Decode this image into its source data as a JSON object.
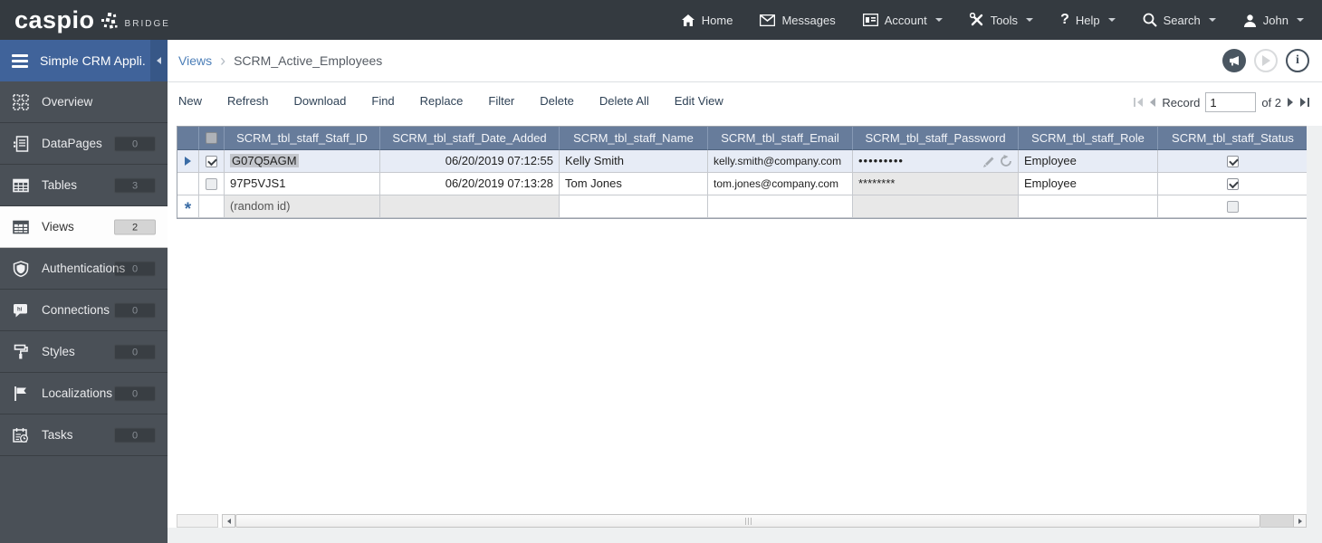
{
  "navbar": {
    "logo": "caspio",
    "logo_suffix": "BRIDGE",
    "items": [
      {
        "label": "Home",
        "icon": "home-icon",
        "dropdown": false
      },
      {
        "label": "Messages",
        "icon": "messages-icon",
        "dropdown": false
      },
      {
        "label": "Account",
        "icon": "account-icon",
        "dropdown": true
      },
      {
        "label": "Tools",
        "icon": "tools-icon",
        "dropdown": true
      },
      {
        "label": "Help",
        "icon": "help-icon",
        "dropdown": true
      },
      {
        "label": "Search",
        "icon": "search-icon",
        "dropdown": true
      },
      {
        "label": "John",
        "icon": "user-icon",
        "dropdown": true
      }
    ]
  },
  "sidebar": {
    "app_name": "Simple CRM Appli...",
    "items": [
      {
        "label": "Overview",
        "icon": "overview-icon",
        "badge": null,
        "selected": false
      },
      {
        "label": "DataPages",
        "icon": "datapages-icon",
        "badge": "0",
        "selected": false
      },
      {
        "label": "Tables",
        "icon": "tables-icon",
        "badge": "3",
        "selected": false
      },
      {
        "label": "Views",
        "icon": "views-icon",
        "badge": "2",
        "selected": true
      },
      {
        "label": "Authentications",
        "icon": "authentications-icon",
        "badge": "0",
        "selected": false
      },
      {
        "label": "Connections",
        "icon": "connections-icon",
        "badge": "0",
        "selected": false
      },
      {
        "label": "Styles",
        "icon": "styles-icon",
        "badge": "0",
        "selected": false
      },
      {
        "label": "Localizations",
        "icon": "localizations-icon",
        "badge": "0",
        "selected": false
      },
      {
        "label": "Tasks",
        "icon": "tasks-icon",
        "badge": "0",
        "selected": false
      }
    ]
  },
  "breadcrumb": {
    "parent": "Views",
    "current": "SCRM_Active_Employees"
  },
  "page_header_icons": [
    "announcement-icon",
    "play-icon",
    "info-icon"
  ],
  "toolbar": {
    "buttons": [
      "New",
      "Refresh",
      "Download",
      "Find",
      "Replace",
      "Filter",
      "Delete",
      "Delete All",
      "Edit View"
    ]
  },
  "record_nav": {
    "label": "Record",
    "current": "1",
    "of_label": "of 2"
  },
  "table": {
    "columns": [
      "SCRM_tbl_staff_Staff_ID",
      "SCRM_tbl_staff_Date_Added",
      "SCRM_tbl_staff_Name",
      "SCRM_tbl_staff_Email",
      "SCRM_tbl_staff_Password",
      "SCRM_tbl_staff_Role",
      "SCRM_tbl_staff_Status"
    ],
    "rows": [
      {
        "staff_id": "G07Q5AGM",
        "date_added": "06/20/2019 07:12:55",
        "name": "Kelly Smith",
        "email": "kelly.smith@company.com",
        "password": "•••••••••",
        "role": "Employee",
        "status_checked": true,
        "row_checked": true,
        "selected": true
      },
      {
        "staff_id": "97P5VJS1",
        "date_added": "06/20/2019 07:13:28",
        "name": "Tom Jones",
        "email": "tom.jones@company.com",
        "password": "********",
        "role": "Employee",
        "status_checked": true,
        "row_checked": false,
        "selected": false
      }
    ],
    "new_row": {
      "staff_id_placeholder": "(random id)"
    }
  },
  "colors": {
    "navbar_bg": "#343a40",
    "sidebar_bg": "#4a5057",
    "sidebar_header_bg": "#40639a",
    "selected_item_bg": "#fdfdfd",
    "table_header_bg": "#677c9b",
    "selected_row_bg": "#e7ecf6",
    "disabled_cell_bg": "#e8e8e8",
    "link_blue": "#4d7fb8",
    "accent_blue": "#3a6ca5"
  }
}
